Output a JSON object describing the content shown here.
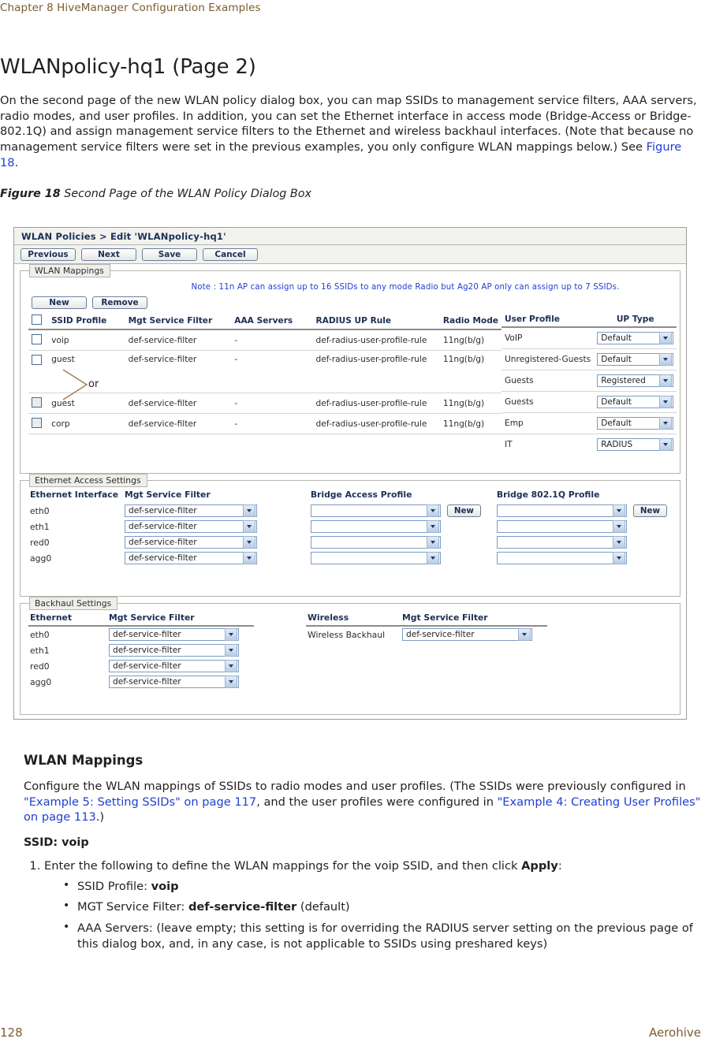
{
  "running_head": "Chapter 8 HiveManager Configuration Examples",
  "footer": {
    "page_number": "128",
    "brand": "Aerohive"
  },
  "page": {
    "title": "WLANpolicy-hq1 (Page 2)",
    "intro_part1": "On the second page of the new WLAN policy dialog box, you can map SSIDs to management service filters, AAA servers, radio modes, and user profiles. In addition, you can set the Ethernet interface in access mode (Bridge-Access or Bridge-802.1Q) and assign management service filters to the Ethernet and wireless backhaul interfaces. (Note that because no management service filters were set in the previous examples, you only configure WLAN mappings below.) See ",
    "intro_link": "Figure 18",
    "intro_part2": "."
  },
  "figure": {
    "label": "Figure 18",
    "caption": "Second Page of the WLAN Policy Dialog Box"
  },
  "screenshot": {
    "titlebar": "WLAN Policies > Edit 'WLANpolicy-hq1'",
    "toolbar_buttons": [
      {
        "label": "Previous"
      },
      {
        "label": "Next"
      },
      {
        "label": "Save"
      },
      {
        "label": "Cancel"
      }
    ],
    "wlan_mappings": {
      "legend": "WLAN Mappings",
      "note": "Note : 11n AP can assign up to 16 SSIDs to any mode Radio but Ag20 AP only can assign up to 7 SSIDs.",
      "new_button": "New",
      "remove_button": "Remove",
      "columns": {
        "ssid_profile": "SSID Profile",
        "mgt_service_filter": "Mgt Service Filter",
        "aaa_servers": "AAA Servers",
        "radius_up_rule": "RADIUS UP Rule",
        "radio_mode": "Radio Mode",
        "user_profile": "User Profile",
        "up_type": "UP Type"
      },
      "rows": [
        {
          "ssid_profile": "voip",
          "mgt_service_filter": "def-service-filter",
          "aaa_servers": "-",
          "radius_up_rule": "def-radius-user-profile-rule",
          "radio_mode": "11ng(b/g)"
        },
        {
          "ssid_profile": "guest",
          "mgt_service_filter": "def-service-filter",
          "aaa_servers": "-",
          "radius_up_rule": "def-radius-user-profile-rule",
          "radio_mode": "11ng(b/g)"
        },
        {
          "ssid_profile": "guest",
          "mgt_service_filter": "def-service-filter",
          "aaa_servers": "-",
          "radius_up_rule": "def-radius-user-profile-rule",
          "radio_mode": "11ng(b/g)"
        },
        {
          "ssid_profile": "corp",
          "mgt_service_filter": "def-service-filter",
          "aaa_servers": "-",
          "radius_up_rule": "def-radius-user-profile-rule",
          "radio_mode": "11ng(b/g)"
        }
      ],
      "profile_rows": [
        {
          "user_profile": "VoIP",
          "up_type": "Default"
        },
        {
          "user_profile": "Unregistered-Guests",
          "up_type": "Default"
        },
        {
          "user_profile": "Guests",
          "up_type": "Registered"
        },
        {
          "user_profile": "Guests",
          "up_type": "Default"
        },
        {
          "user_profile": "Emp",
          "up_type": "Default"
        },
        {
          "user_profile": "IT",
          "up_type": "RADIUS"
        }
      ],
      "or_annotation": "or"
    },
    "ethernet_access": {
      "legend": "Ethernet Access Settings",
      "columns": {
        "ethernet_interface": "Ethernet Interface",
        "mgt_service_filter": "Mgt Service Filter",
        "bridge_access_profile": "Bridge Access Profile",
        "bridge_8021q_profile": "Bridge 802.1Q Profile"
      },
      "new_button": "New",
      "rows": [
        {
          "interface": "eth0",
          "mgt_service_filter": "def-service-filter",
          "bridge_access_profile": "",
          "bridge_8021q_profile": ""
        },
        {
          "interface": "eth1",
          "mgt_service_filter": "def-service-filter",
          "bridge_access_profile": "",
          "bridge_8021q_profile": ""
        },
        {
          "interface": "red0",
          "mgt_service_filter": "def-service-filter",
          "bridge_access_profile": "",
          "bridge_8021q_profile": ""
        },
        {
          "interface": "agg0",
          "mgt_service_filter": "def-service-filter",
          "bridge_access_profile": "",
          "bridge_8021q_profile": ""
        }
      ]
    },
    "backhaul": {
      "legend": "Backhaul Settings",
      "columns": {
        "ethernet": "Ethernet",
        "mgt_service_filter": "Mgt Service Filter",
        "wireless": "Wireless",
        "wireless_mgt_service_filter": "Mgt Service Filter"
      },
      "ethernet_rows": [
        {
          "interface": "eth0",
          "mgt_service_filter": "def-service-filter"
        },
        {
          "interface": "eth1",
          "mgt_service_filter": "def-service-filter"
        },
        {
          "interface": "red0",
          "mgt_service_filter": "def-service-filter"
        },
        {
          "interface": "agg0",
          "mgt_service_filter": "def-service-filter"
        }
      ],
      "wireless_rows": [
        {
          "interface": "Wireless Backhaul",
          "mgt_service_filter": "def-service-filter"
        }
      ]
    }
  },
  "lower": {
    "heading": "WLAN Mappings",
    "para_a": "Configure the WLAN mappings of SSIDs to radio modes and user profiles. (The SSIDs were previously configured in ",
    "link_1": "\"Example 5: Setting SSIDs\" on page 117",
    "para_b": ", and the user profiles were configured in ",
    "link_2": "\"Example 4: Creating User Profiles\" on page 113",
    "para_c": ".)",
    "ssid_heading": "SSID: voip",
    "step_1_pre": "Enter the following to define the WLAN mappings for the voip SSID, and then click ",
    "step_1_bold": "Apply",
    "step_1_post": ":",
    "bullets": [
      {
        "label": "SSID Profile: ",
        "bold": "voip",
        "tail": ""
      },
      {
        "label": "MGT Service Filter: ",
        "bold": "def-service-filter",
        "tail": " (default)"
      },
      {
        "label": "AAA Servers: (leave empty; this setting is for overriding the RADIUS server setting on the previous page of this dialog box, and, in any case, is not applicable to SSIDs using preshared keys)",
        "bold": "",
        "tail": ""
      }
    ]
  },
  "colors": {
    "running_head": "#7a5c2e",
    "link": "#1f3fd0",
    "app_header_text": "#1b2f55",
    "note_text": "#1f3fd0"
  }
}
